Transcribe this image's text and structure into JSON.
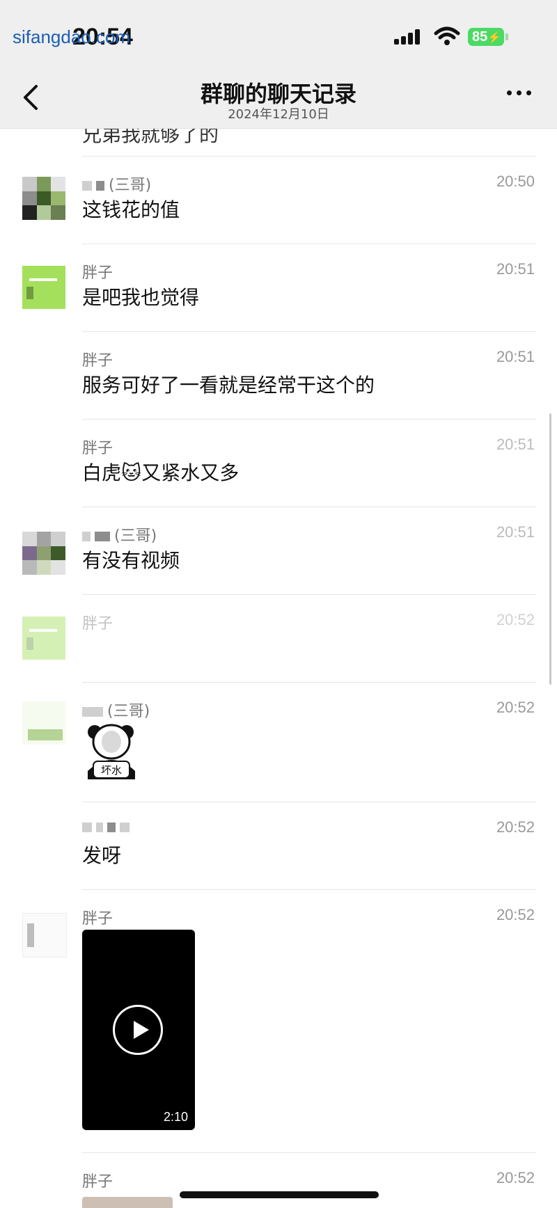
{
  "status_bar": {
    "watermark": "sifangdao.com",
    "time": "20:54",
    "battery": "85"
  },
  "nav": {
    "title": "群聊的聊天记录",
    "date": "2024年12月10日"
  },
  "partial_top_text": "兄弟我就够了的",
  "messages": [
    {
      "sender": "(三哥)",
      "time": "20:50",
      "text": "这钱花的值"
    },
    {
      "sender": "胖子",
      "time": "20:51",
      "text": "是吧我也觉得"
    },
    {
      "sender": "胖子",
      "time": "20:51",
      "text": "服务可好了一看就是经常干这个的"
    },
    {
      "sender": "胖子",
      "time": "20:51",
      "text": "白虎🐱又紧水又多"
    },
    {
      "sender": "(三哥)",
      "time": "20:51",
      "text": "有没有视频"
    },
    {
      "sender": "胖子",
      "time": "20:52",
      "text": ""
    },
    {
      "sender": "(三哥)",
      "time": "20:52",
      "sticker_label": "坏水"
    },
    {
      "sender": "",
      "time": "20:52",
      "text": "发呀"
    },
    {
      "sender": "胖子",
      "time": "20:52",
      "video_duration": "2:10"
    },
    {
      "sender": "胖子",
      "time": "20:52"
    }
  ]
}
